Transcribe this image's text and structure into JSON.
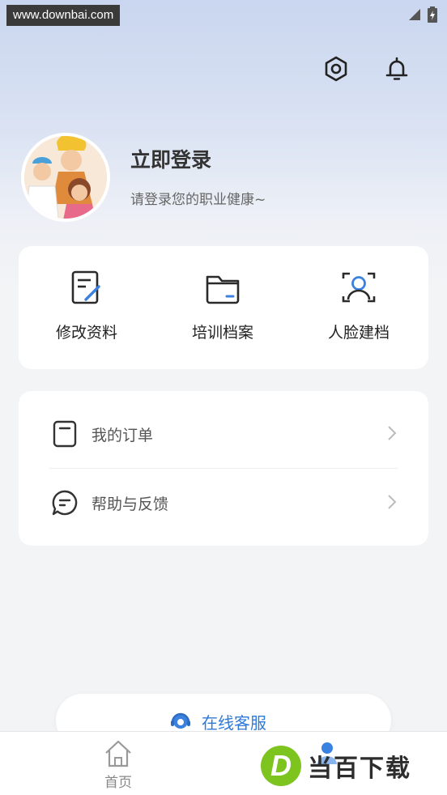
{
  "watermark": "www.downbai.com",
  "profile": {
    "title": "立即登录",
    "subtitle": "请登录您的职业健康~"
  },
  "quick_actions": [
    {
      "label": "修改资料",
      "icon": "edit-document-icon"
    },
    {
      "label": "培训档案",
      "icon": "folder-icon"
    },
    {
      "label": "人脸建档",
      "icon": "face-scan-icon"
    }
  ],
  "menu": [
    {
      "label": "我的订单",
      "icon": "order-icon"
    },
    {
      "label": "帮助与反馈",
      "icon": "feedback-icon"
    }
  ],
  "customer_service": {
    "label": "在线客服",
    "icon": "headset-icon"
  },
  "tabbar": {
    "home_label": "首页"
  },
  "logo_watermark": {
    "letter": "D",
    "text": "当百下载"
  },
  "colors": {
    "accent": "#2f7ad8",
    "icon_blue": "#3b82e0",
    "logo_green": "#7dc41f"
  }
}
